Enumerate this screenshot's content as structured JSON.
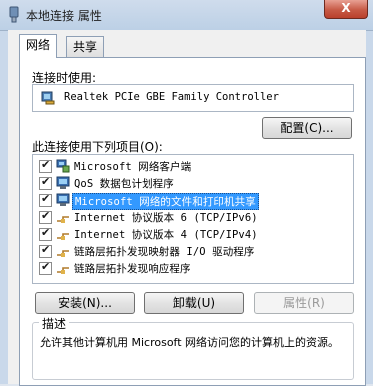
{
  "window": {
    "title": "本地连接 属性",
    "close_label": "X"
  },
  "tabs": [
    {
      "label": "网络"
    },
    {
      "label": "共享"
    }
  ],
  "connect_using": {
    "label": "连接时使用:",
    "adapter": "Realtek PCIe GBE Family Controller"
  },
  "configure_button": "配置(C)...",
  "items_label": "此连接使用下列项目(O):",
  "items": [
    {
      "text": "Microsoft 网络客户端",
      "checked": true,
      "icon": "network-client-icon"
    },
    {
      "text": "QoS 数据包计划程序",
      "checked": true,
      "icon": "qos-scheduler-icon"
    },
    {
      "text": "Microsoft 网络的文件和打印机共享",
      "checked": true,
      "selected": true,
      "icon": "file-printer-sharing-icon"
    },
    {
      "text": "Internet 协议版本 6 (TCP/IPv6)",
      "checked": true,
      "icon": "protocol-icon"
    },
    {
      "text": "Internet 协议版本 4 (TCP/IPv4)",
      "checked": true,
      "icon": "protocol-icon"
    },
    {
      "text": "链路层拓扑发现映射器 I/O 驱动程序",
      "checked": true,
      "icon": "protocol-icon"
    },
    {
      "text": "链路层拓扑发现响应程序",
      "checked": true,
      "icon": "protocol-icon"
    }
  ],
  "buttons": {
    "install": "安装(N)...",
    "uninstall": "卸载(U)",
    "properties": "属性(R)"
  },
  "description": {
    "title": "描述",
    "text": "允许其他计算机用 Microsoft 网络访问您的计算机上的资源。"
  },
  "colors": {
    "selection": "#3399ff",
    "title_bar": "#c9d8ea",
    "close_button": "#c75a46"
  }
}
